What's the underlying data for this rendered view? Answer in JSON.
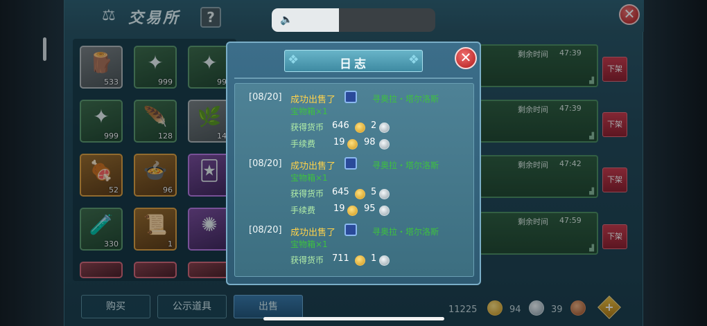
{
  "window": {
    "title": "交易所",
    "help_label": "?",
    "close_label": "✕"
  },
  "inventory": [
    {
      "qty": "533",
      "icon": "wood-log-icon",
      "glyph": "🪵",
      "frame": "gray"
    },
    {
      "qty": "999",
      "icon": "green-compass-orb-icon",
      "glyph": "✦",
      "frame": "green"
    },
    {
      "qty": "99",
      "icon": "green-compass-orb-icon",
      "glyph": "✦",
      "frame": "green"
    },
    {
      "qty": "999",
      "icon": "green-compass-orb-icon",
      "glyph": "✦",
      "frame": "green"
    },
    {
      "qty": "128",
      "icon": "leaf-blade-icon",
      "glyph": "🪶",
      "frame": "green"
    },
    {
      "qty": "14",
      "icon": "golden-branch-icon",
      "glyph": "🌿",
      "frame": "gray"
    },
    {
      "qty": "52",
      "icon": "meat-dish-icon",
      "glyph": "🍖",
      "frame": "orange"
    },
    {
      "qty": "96",
      "icon": "noodle-dish-icon",
      "glyph": "🍲",
      "frame": "orange"
    },
    {
      "qty": "",
      "icon": "purple-card-icon",
      "glyph": "🃏",
      "frame": "purple"
    },
    {
      "qty": "330",
      "icon": "potion-flask-icon",
      "glyph": "🧪",
      "frame": "green"
    },
    {
      "qty": "1",
      "icon": "dark-scroll-icon",
      "glyph": "📜",
      "frame": "orange"
    },
    {
      "qty": "",
      "icon": "purple-rune-icon",
      "glyph": "✺",
      "frame": "purple"
    }
  ],
  "listings": [
    {
      "label": "剩余时间",
      "time": "47:39"
    },
    {
      "label": "剩余时间",
      "time": "47:39"
    },
    {
      "label": "剩余时间",
      "time": "47:42"
    },
    {
      "label": "剩余时间",
      "time": "47:59"
    }
  ],
  "delist_label": "下架",
  "bottom": {
    "tabs": [
      "购买",
      "公示道具",
      "出售"
    ],
    "active_tab": "出售",
    "gold": "11225",
    "silver": "94",
    "copper": "39",
    "add_label": "+"
  },
  "volume": {
    "level": 0.41,
    "icon": "speaker-icon"
  },
  "log_dialog": {
    "title": "日志",
    "close_label": "✕",
    "entries": [
      {
        "date": "[08/20]",
        "action": "成功出售了",
        "item_line1": "寻奥拉・塔尔洛斯",
        "item_line2": "宝物箱×1",
        "earn_label": "获得货币",
        "earn_gold": "646",
        "earn_silver": "2",
        "fee_label": "手续费",
        "fee_gold": "19",
        "fee_silver": "98"
      },
      {
        "date": "[08/20]",
        "action": "成功出售了",
        "item_line1": "寻奥拉・塔尔洛斯",
        "item_line2": "宝物箱×1",
        "earn_label": "获得货币",
        "earn_gold": "645",
        "earn_silver": "5",
        "fee_label": "手续费",
        "fee_gold": "19",
        "fee_silver": "95"
      },
      {
        "date": "[08/20]",
        "action": "成功出售了",
        "item_line1": "寻奥拉・塔尔洛斯",
        "item_line2": "宝物箱×1",
        "earn_label": "获得货币",
        "earn_gold": "711",
        "earn_silver": "1"
      }
    ]
  }
}
